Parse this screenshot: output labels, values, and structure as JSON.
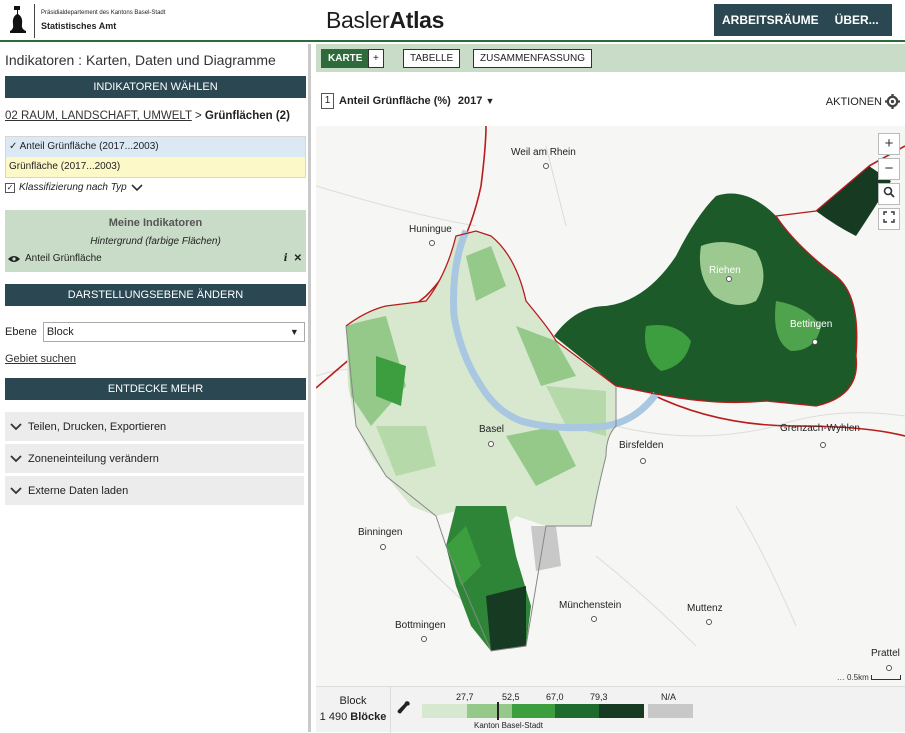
{
  "header": {
    "dept_line1": "Präsidialdepartement des Kantons Basel-Stadt",
    "dept_line2": "Statistisches Amt",
    "brand_light": "Basler",
    "brand_bold": "Atlas",
    "nav_workspaces": "ARBEITSRÄUME",
    "nav_about": "ÜBER...",
    "user_icon": "user-icon"
  },
  "left": {
    "title": "Indikatoren : Karten, Daten und Diagramme",
    "choose_bar": "INDIKATOREN WÄHLEN",
    "breadcrumb_link": "02 RAUM, LANDSCHAFT, UMWELT",
    "breadcrumb_sep": ">",
    "breadcrumb_current": "Grünflächen (2)",
    "indicators": [
      "✓ Anteil Grünfläche (2017...2003)",
      "Grünfläche (2017...2003)"
    ],
    "klassifizierung": "Klassifizierung nach Typ",
    "my_title": "Meine Indikatoren",
    "my_sub": "Hintergrund (farbige Flächen)",
    "my_item": "Anteil Grünfläche",
    "level_bar": "DARSTELLUNGSEBENE ÄNDERN",
    "level_label": "Ebene",
    "level_value": "Block",
    "area_search": "Gebiet suchen",
    "discover_bar": "ENTDECKE MEHR",
    "acc1": "Teilen, Drucken, Exportieren",
    "acc2": "Zoneneinteilung verändern",
    "acc3": "Externe Daten laden"
  },
  "map": {
    "tab_map": "KARTE",
    "tab_plus": "+",
    "tab_table": "TABELLE",
    "tab_summary": "ZUSAMMENFASSUNG",
    "ind_number": "1",
    "ind_name": "Anteil Grünfläche (%)",
    "year": "2017",
    "actions": "AKTIONEN",
    "zoom_in": "+",
    "zoom_out": "−",
    "places": {
      "weil": "Weil am Rhein",
      "huningue": "Huningue",
      "riehen": "Riehen",
      "bettingen": "Bettingen",
      "basel": "Basel",
      "birsfelden": "Birsfelden",
      "grenzach": "Grenzach-Wyhlen",
      "binningen": "Binningen",
      "muenchenstein": "Münchenstein",
      "muttenz": "Muttenz",
      "bottmingen": "Bottmingen",
      "pratteln": "Prattel"
    },
    "scale_label": "0.5km"
  },
  "legend": {
    "level": "Block",
    "count_num": "1 490",
    "count_unit": "Blöcke",
    "breaks": [
      "27,7",
      "52,5",
      "67,0",
      "79,3"
    ],
    "na": "N/A",
    "region": "Kanton Basel-Stadt",
    "colors": [
      "#d6e8cf",
      "#94c98a",
      "#3d9e3f",
      "#1d6b2d",
      "#163b22"
    ],
    "na_color": "#c8c8c8"
  }
}
